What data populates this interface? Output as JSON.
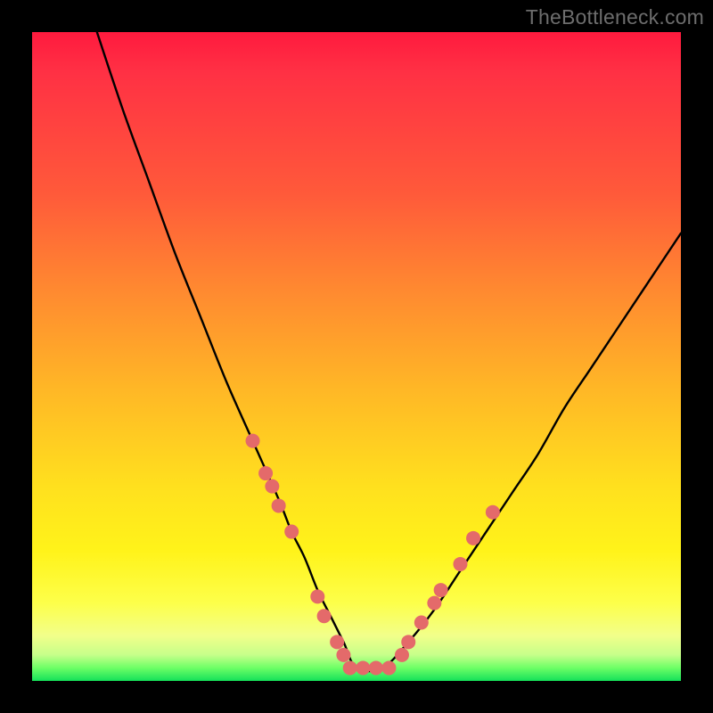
{
  "watermark": "TheBottleneck.com",
  "chart_data": {
    "type": "line",
    "title": "",
    "xlabel": "",
    "ylabel": "",
    "xlim": [
      0,
      100
    ],
    "ylim": [
      0,
      100
    ],
    "grid": false,
    "legend": false,
    "series": [
      {
        "name": "bottleneck-curve",
        "stroke": "#000000",
        "x": [
          10,
          14,
          18,
          22,
          26,
          30,
          34,
          38,
          40,
          42,
          44,
          46,
          48,
          50,
          54,
          58,
          62,
          66,
          70,
          74,
          78,
          82,
          86,
          90,
          94,
          98,
          100
        ],
        "y": [
          100,
          88,
          77,
          66,
          56,
          46,
          37,
          28,
          23,
          19,
          14,
          10,
          6,
          2,
          2,
          6,
          11,
          17,
          23,
          29,
          35,
          42,
          48,
          54,
          60,
          66,
          69
        ]
      }
    ],
    "markers": [
      {
        "name": "highlighted-points",
        "color": "#e46a6a",
        "radius": 8,
        "points": [
          {
            "x": 34,
            "y": 37
          },
          {
            "x": 36,
            "y": 32
          },
          {
            "x": 37,
            "y": 30
          },
          {
            "x": 38,
            "y": 27
          },
          {
            "x": 40,
            "y": 23
          },
          {
            "x": 44,
            "y": 13
          },
          {
            "x": 45,
            "y": 10
          },
          {
            "x": 47,
            "y": 6
          },
          {
            "x": 48,
            "y": 4
          },
          {
            "x": 49,
            "y": 2
          },
          {
            "x": 51,
            "y": 2
          },
          {
            "x": 53,
            "y": 2
          },
          {
            "x": 55,
            "y": 2
          },
          {
            "x": 57,
            "y": 4
          },
          {
            "x": 58,
            "y": 6
          },
          {
            "x": 60,
            "y": 9
          },
          {
            "x": 62,
            "y": 12
          },
          {
            "x": 63,
            "y": 14
          },
          {
            "x": 66,
            "y": 18
          },
          {
            "x": 68,
            "y": 22
          },
          {
            "x": 71,
            "y": 26
          }
        ]
      }
    ],
    "background_gradient": {
      "top": "#ff1a3e",
      "bottom": "#14e05a"
    }
  }
}
